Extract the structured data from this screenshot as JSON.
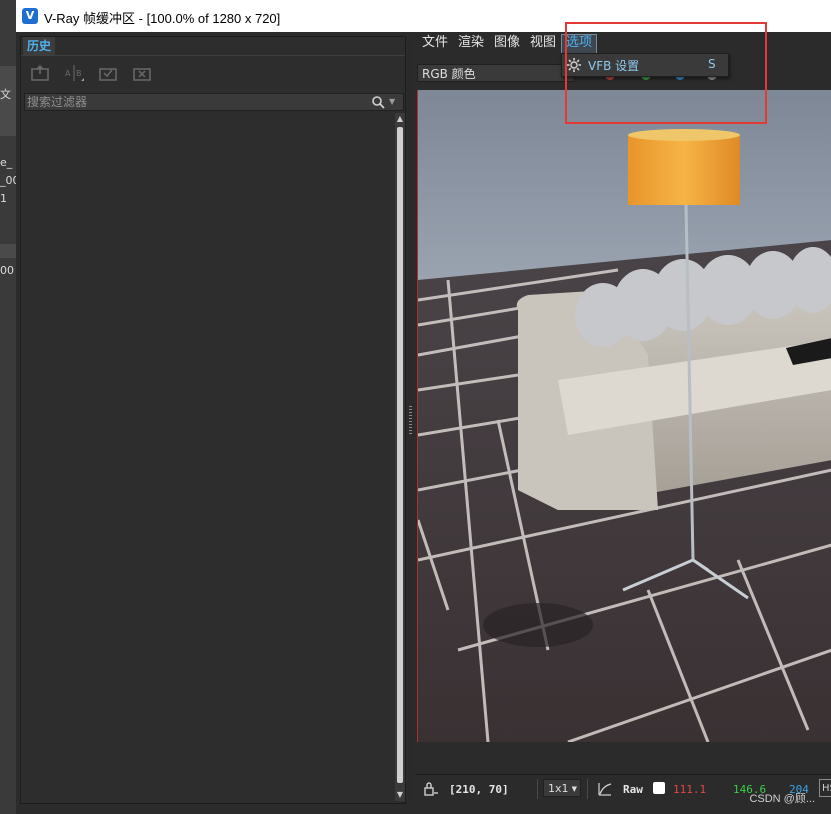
{
  "window": {
    "title": "V-Ray 帧缓冲区 - [100.0% of 1280 x 720]"
  },
  "background_app": {
    "fragments": [
      "文",
      "e_",
      "_00",
      "1",
      "00"
    ]
  },
  "history_panel": {
    "tab_label": "历史",
    "tools": [
      "save-to-history-icon",
      "ab-compare-icon",
      "load-from-history-icon",
      "remove-from-history-icon"
    ],
    "search_placeholder": "搜索过滤器"
  },
  "menu": {
    "items": [
      {
        "label": "文件"
      },
      {
        "label": "渲染"
      },
      {
        "label": "图像"
      },
      {
        "label": "视图"
      },
      {
        "label": "选项"
      }
    ],
    "active_index": 4
  },
  "toolbar": {
    "channel": "RGB 颜色",
    "channel_dots": [
      "#c84848",
      "#3fa64b",
      "#3b8fd0",
      "#9a9a9a"
    ]
  },
  "dropdown": {
    "items": [
      {
        "label": "VFB 设置",
        "shortcut": "S",
        "icon": "gear-icon"
      }
    ]
  },
  "status": {
    "coords": "[210,  70]",
    "zoom": "1x1",
    "mode": "Raw",
    "r": "111.1",
    "g": "146.6",
    "b": "204",
    "colorspace": "HS",
    "colors": {
      "r": "#e04848",
      "g": "#38d04a",
      "b": "#3aa0e8"
    }
  },
  "watermark": "CSDN @顾..."
}
